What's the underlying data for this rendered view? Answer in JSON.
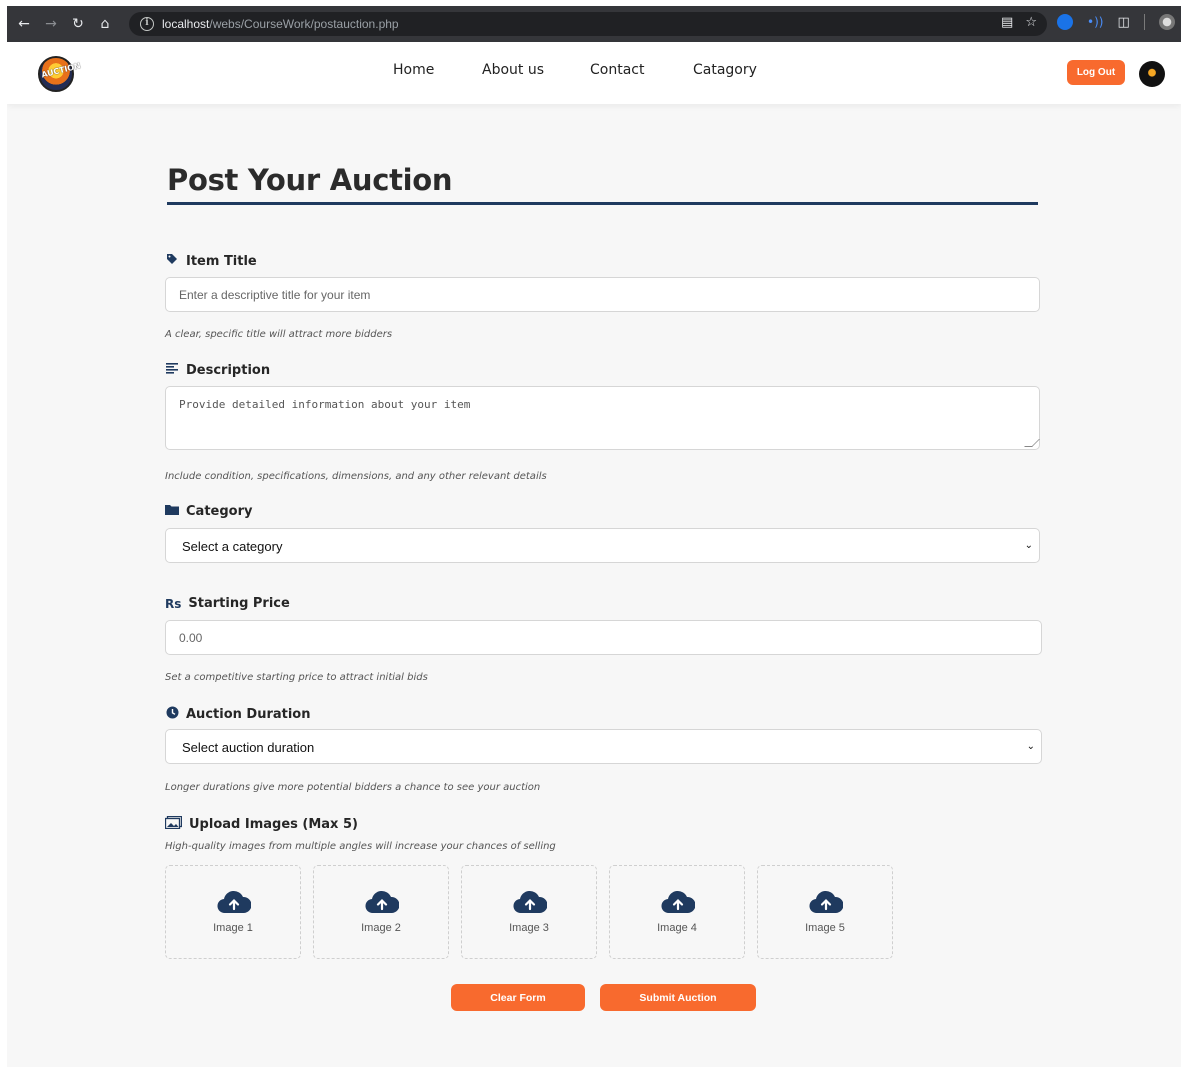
{
  "browser": {
    "url_host": "localhost",
    "url_path": "/webs/CourseWork/postauction.php"
  },
  "header": {
    "logo_text": "AUCTION",
    "nav": [
      "Home",
      "About us",
      "Contact",
      "Catagory"
    ],
    "logout_label": "Log Out"
  },
  "page": {
    "title": "Post Your Auction"
  },
  "form": {
    "item_title": {
      "label": "Item Title",
      "placeholder": "Enter a descriptive title for your item",
      "hint": "A clear, specific title will attract more bidders"
    },
    "description": {
      "label": "Description",
      "placeholder": "Provide detailed information about your item",
      "hint": "Include condition, specifications, dimensions, and any other relevant details"
    },
    "category": {
      "label": "Category",
      "selected": "Select a category"
    },
    "starting_price": {
      "label": "Starting Price",
      "currency_symbol": "Rs",
      "placeholder": "0.00",
      "hint": "Set a competitive starting price to attract initial bids"
    },
    "duration": {
      "label": "Auction Duration",
      "selected": "Select auction duration",
      "hint": "Longer durations give more potential bidders a chance to see your auction"
    },
    "images": {
      "label": "Upload Images (Max 5)",
      "hint": "High-quality images from multiple angles will increase your chances of selling",
      "slots": [
        "Image 1",
        "Image 2",
        "Image 3",
        "Image 4",
        "Image 5"
      ]
    },
    "clear_label": "Clear Form",
    "submit_label": "Submit Auction"
  },
  "colors": {
    "accent": "#f86a2e",
    "navy": "#1f3a5f",
    "background": "#f7f7f7"
  }
}
